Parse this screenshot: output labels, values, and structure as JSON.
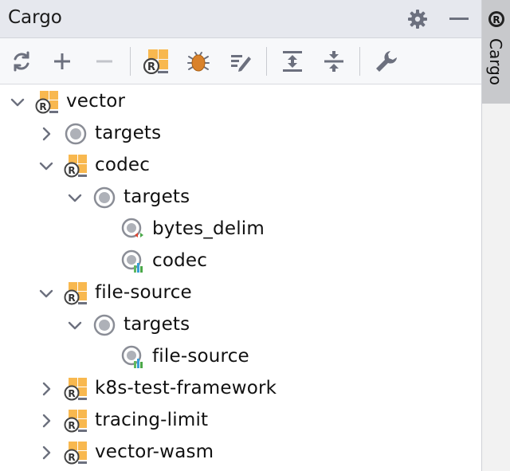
{
  "panel": {
    "title": "Cargo"
  },
  "side_tab": {
    "label": "Cargo"
  },
  "toolbar": {
    "buttons": [
      {
        "name": "refresh",
        "icon": "refresh-icon"
      },
      {
        "name": "add",
        "icon": "plus-icon"
      },
      {
        "name": "remove",
        "icon": "minus-icon",
        "disabled": true
      },
      {
        "name": "cargo-project",
        "icon": "cargo-crate-icon"
      },
      {
        "name": "debug",
        "icon": "bug-icon"
      },
      {
        "name": "edit",
        "icon": "edit-icon"
      },
      {
        "name": "expand-all",
        "icon": "expand-all-icon"
      },
      {
        "name": "collapse-all",
        "icon": "collapse-all-icon"
      },
      {
        "name": "settings",
        "icon": "wrench-icon"
      }
    ]
  },
  "tree": [
    {
      "label": "vector",
      "type": "crate",
      "expanded": true,
      "level": 0
    },
    {
      "label": "targets",
      "type": "targets",
      "expanded": false,
      "level": 1
    },
    {
      "label": "codec",
      "type": "crate",
      "expanded": true,
      "level": 1
    },
    {
      "label": "targets",
      "type": "targets",
      "expanded": true,
      "level": 2
    },
    {
      "label": "bytes_delim",
      "type": "target-bin",
      "level": 3
    },
    {
      "label": "codec",
      "type": "target-lib",
      "level": 3
    },
    {
      "label": "file-source",
      "type": "crate",
      "expanded": true,
      "level": 1
    },
    {
      "label": "targets",
      "type": "targets",
      "expanded": true,
      "level": 2
    },
    {
      "label": "file-source",
      "type": "target-lib",
      "level": 3
    },
    {
      "label": "k8s-test-framework",
      "type": "crate",
      "expanded": false,
      "level": 1
    },
    {
      "label": "tracing-limit",
      "type": "crate",
      "expanded": false,
      "level": 1
    },
    {
      "label": "vector-wasm",
      "type": "crate",
      "expanded": false,
      "level": 1
    }
  ],
  "colors": {
    "titlebar_bg": "#e6e8ee",
    "toolbar_bg": "#f7f8fa",
    "icon_gray": "#6c707e",
    "crate_orange": "#f8b84f",
    "side_tab_bg": "#c8c9cc"
  }
}
